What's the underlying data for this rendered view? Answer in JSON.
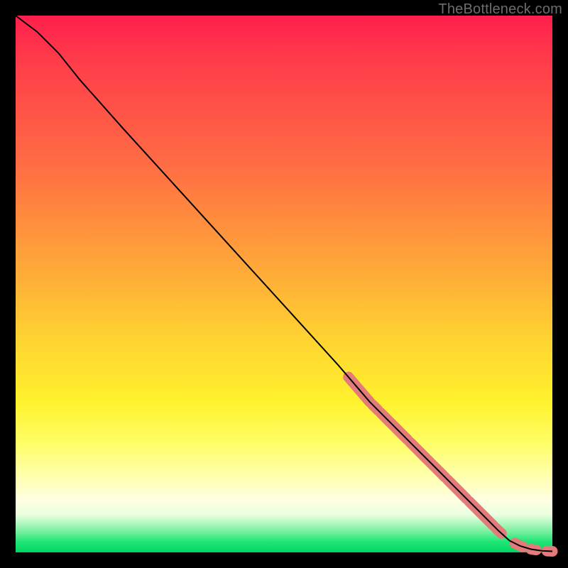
{
  "watermark": "TheBottleneck.com",
  "colors": {
    "blob": "#e47a7a",
    "line": "#000000",
    "frame": "#000000"
  },
  "chart_data": {
    "type": "line",
    "title": "",
    "xlabel": "",
    "ylabel": "",
    "xlim": [
      0,
      100
    ],
    "ylim": [
      0,
      100
    ],
    "grid": false,
    "series": [
      {
        "name": "curve",
        "x": [
          0,
          4,
          8,
          12,
          20,
          30,
          40,
          50,
          60,
          66,
          70,
          74,
          78,
          82,
          86,
          90,
          92,
          94,
          96,
          98,
          100
        ],
        "y": [
          100,
          97,
          93,
          88,
          79,
          68,
          57,
          46,
          35,
          28,
          24,
          20,
          16,
          12,
          8,
          4,
          2.2,
          1.2,
          0.6,
          0.3,
          0.2
        ]
      }
    ],
    "highlight_segments": [
      {
        "x0": 62,
        "x1": 66
      },
      {
        "x0": 66.5,
        "x1": 67.5
      },
      {
        "x0": 68,
        "x1": 73
      },
      {
        "x0": 73.5,
        "x1": 80
      },
      {
        "x0": 80.5,
        "x1": 84
      },
      {
        "x0": 84.5,
        "x1": 89
      },
      {
        "x0": 89.5,
        "x1": 90.5
      },
      {
        "x0": 93,
        "x1": 94.5
      },
      {
        "x0": 96,
        "x1": 97
      },
      {
        "x0": 99,
        "x1": 100
      }
    ]
  }
}
